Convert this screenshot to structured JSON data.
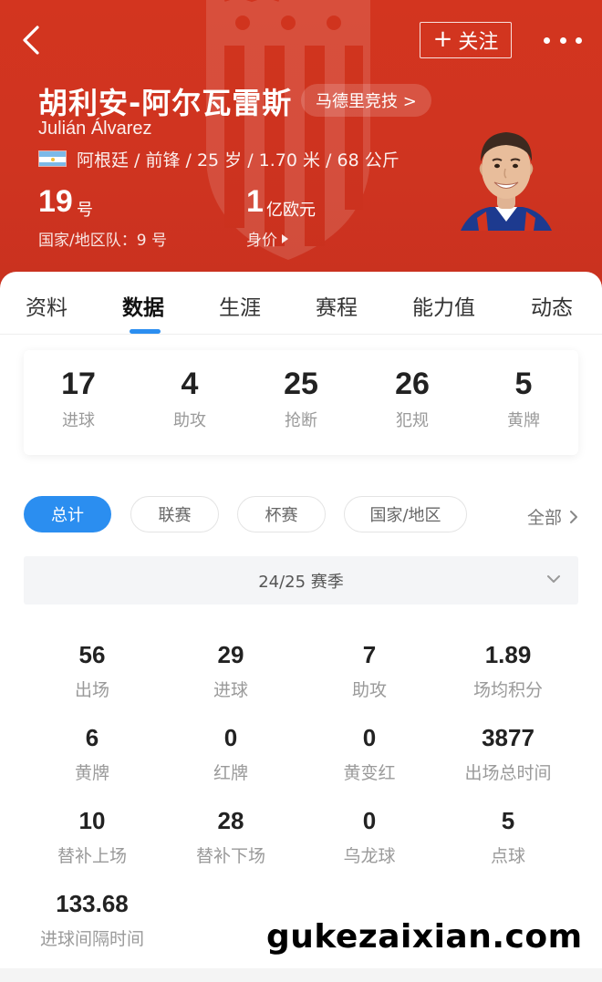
{
  "header": {
    "follow_label": "关注",
    "player_name": "胡利安-阿尔瓦雷斯",
    "club": "马德里竞技 >",
    "latin_name": "Julián Álvarez",
    "bio": "阿根廷 / 前锋 / 25 岁 / 1.70 米 / 68 公斤",
    "number": "19",
    "number_unit": "号",
    "national_team": "国家/地区队：9 号",
    "value": "1",
    "value_unit": "亿欧元",
    "value_label": "身价"
  },
  "tabs": [
    {
      "label": "资料"
    },
    {
      "label": "数据"
    },
    {
      "label": "生涯"
    },
    {
      "label": "赛程"
    },
    {
      "label": "能力值"
    },
    {
      "label": "动态"
    }
  ],
  "active_tab": "数据",
  "summary": [
    {
      "value": "17",
      "label": "进球"
    },
    {
      "value": "4",
      "label": "助攻"
    },
    {
      "value": "25",
      "label": "抢断"
    },
    {
      "value": "26",
      "label": "犯规"
    },
    {
      "value": "5",
      "label": "黄牌"
    }
  ],
  "filters": [
    {
      "label": "总计"
    },
    {
      "label": "联赛"
    },
    {
      "label": "杯赛"
    },
    {
      "label": "国家/地区"
    }
  ],
  "filter_all": "全部",
  "season": "24/25 赛季",
  "stats": [
    {
      "value": "56",
      "label": "出场"
    },
    {
      "value": "29",
      "label": "进球"
    },
    {
      "value": "7",
      "label": "助攻"
    },
    {
      "value": "1.89",
      "label": "场均积分"
    },
    {
      "value": "6",
      "label": "黄牌"
    },
    {
      "value": "0",
      "label": "红牌"
    },
    {
      "value": "0",
      "label": "黄变红"
    },
    {
      "value": "3877",
      "label": "出场总时间"
    },
    {
      "value": "10",
      "label": "替补上场"
    },
    {
      "value": "28",
      "label": "替补下场"
    },
    {
      "value": "0",
      "label": "乌龙球"
    },
    {
      "value": "5",
      "label": "点球"
    },
    {
      "value": "133.68",
      "label": "进球间隔时间"
    }
  ],
  "watermark": "gukezaixian.com",
  "colors": {
    "header_red": "#d3351f",
    "accent_blue": "#2b8ef0",
    "argentina_blue": "#7cb9e8"
  },
  "icons": [
    "back-arrow-icon",
    "plus-icon",
    "more-dots-icon",
    "argentina-flag-icon",
    "chevron-right-icon",
    "chevron-down-icon",
    "triangle-right-icon",
    "club-crest-icon"
  ]
}
